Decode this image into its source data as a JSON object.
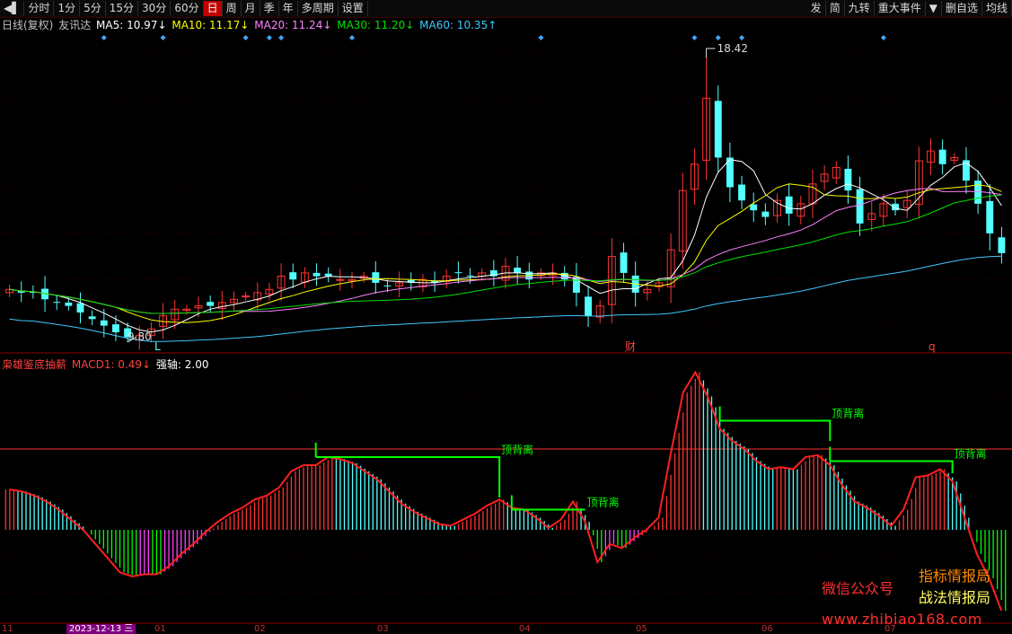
{
  "toolbar": {
    "left_items": [
      "分时",
      "1分",
      "5分",
      "15分",
      "30分",
      "60分",
      "日",
      "周",
      "月",
      "季",
      "年",
      "多周期",
      "设置"
    ],
    "active": "日",
    "right_items": [
      "发",
      "简",
      "九转",
      "重大事件",
      "删自选",
      "均线"
    ]
  },
  "main_legend": {
    "title": "日线(复权)",
    "name": "友讯达",
    "ma5": "MA5: 10.97↓",
    "ma10": "MA10: 11.17↓",
    "ma20": "MA20: 11.24↓",
    "ma30": "MA30: 11.20↓",
    "ma60": "MA60: 10.35↑"
  },
  "sub_legend": {
    "title": "枭雄鉴底抽薪",
    "macd": "MACD1: 0.49↓",
    "axis": "强轴: 2.00"
  },
  "annotations": {
    "high_label": "18.42",
    "low_label": "9.80",
    "marker_L": "L",
    "marker_cai": "财",
    "marker_q": "q",
    "divergence": "顶背离"
  },
  "time_axis": {
    "ticks": [
      "11",
      "2023-12-13 三",
      "01",
      "02",
      "03",
      "04",
      "05",
      "06",
      "07"
    ]
  },
  "watermark": {
    "label": "微信公众号",
    "line1": "指标情报局",
    "line2": "战法情报局",
    "url": "www.zhibiao168.com"
  },
  "colors": {
    "up": "#ff3232",
    "down": "#54ffff",
    "ma5": "#ffffff",
    "ma10": "#ffff00",
    "ma20": "#ff80ff",
    "ma30": "#00e000",
    "ma60": "#40c8ff",
    "divergence": "#00ff00"
  },
  "chart_data": [
    {
      "type": "candlestick",
      "title": "日线(复权)",
      "series": [
        {
          "name": "MA5",
          "value": 10.97
        },
        {
          "name": "MA10",
          "value": 11.17
        },
        {
          "name": "MA20",
          "value": 11.24
        },
        {
          "name": "MA30",
          "value": 11.2
        },
        {
          "name": "MA60",
          "value": 10.35
        }
      ],
      "price_range": [
        9.5,
        19.2
      ],
      "annotated_high": 18.42,
      "annotated_low": 9.8,
      "closes": [
        11.4,
        11.3,
        11.3,
        11.1,
        11.0,
        10.9,
        10.7,
        10.5,
        10.3,
        10.1,
        9.95,
        10.0,
        10.2,
        10.6,
        10.8,
        10.8,
        10.9,
        10.9,
        11.0,
        11.1,
        11.2,
        11.3,
        11.4,
        11.8,
        11.7,
        11.9,
        11.8,
        11.8,
        11.7,
        11.7,
        11.8,
        11.6,
        11.5,
        11.6,
        11.6,
        11.7,
        11.6,
        11.8,
        11.9,
        11.8,
        11.9,
        11.8,
        12.1,
        11.9,
        11.7,
        11.9,
        11.9,
        11.7,
        11.3,
        10.6,
        10.9,
        12.4,
        11.9,
        11.3,
        11.4,
        11.6,
        12.6,
        14.4,
        15.2,
        17.2,
        15.4,
        14.5,
        14.1,
        13.8,
        13.6,
        14.1,
        13.7,
        14.0,
        14.6,
        14.9,
        15.1,
        14.4,
        13.4,
        13.7,
        14.0,
        13.8,
        14.1,
        15.3,
        15.6,
        15.2,
        15.4,
        14.7,
        14.0,
        13.1,
        12.5
      ]
    },
    {
      "type": "bar",
      "title": "枭雄鉴底抽薪",
      "series": [
        {
          "name": "MACD1",
          "value": 0.49
        }
      ],
      "axis_value": 2.0,
      "macd_values": [
        1.0,
        0.95,
        0.85,
        0.7,
        0.5,
        0.25,
        0.0,
        -0.35,
        -0.7,
        -1.05,
        -1.15,
        -1.1,
        -1.1,
        -0.9,
        -0.6,
        -0.35,
        -0.05,
        0.2,
        0.4,
        0.55,
        0.75,
        0.85,
        1.05,
        1.45,
        1.6,
        1.6,
        1.8,
        1.75,
        1.65,
        1.45,
        1.25,
        0.95,
        0.65,
        0.45,
        0.3,
        0.15,
        0.1,
        0.25,
        0.4,
        0.6,
        0.75,
        0.55,
        0.5,
        0.3,
        0.05,
        0.25,
        0.7,
        0.2,
        -0.8,
        -0.35,
        -0.45,
        -0.2,
        0.0,
        0.3,
        1.9,
        3.4,
        3.9,
        3.3,
        2.5,
        2.2,
        2.0,
        1.7,
        1.5,
        1.55,
        1.5,
        1.8,
        1.85,
        1.6,
        1.1,
        0.7,
        0.55,
        0.35,
        0.1,
        0.5,
        1.3,
        1.35,
        1.5,
        1.2,
        0.3,
        -0.6,
        -1.2,
        -2.0
      ]
    }
  ]
}
